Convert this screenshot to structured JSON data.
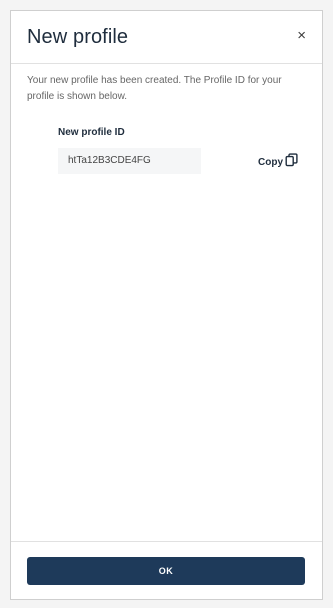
{
  "dialog": {
    "title": "New profile",
    "close_label": "×",
    "description": "Your new profile has been created. The Profile ID for your profile is shown below.",
    "field_label": "New profile ID",
    "profile_id": "htTa12B3CDE4FG",
    "copy_label": "Copy",
    "copy_icon": "copy-icon",
    "ok_label": "OK",
    "accent_color": "#1e3a5a"
  }
}
